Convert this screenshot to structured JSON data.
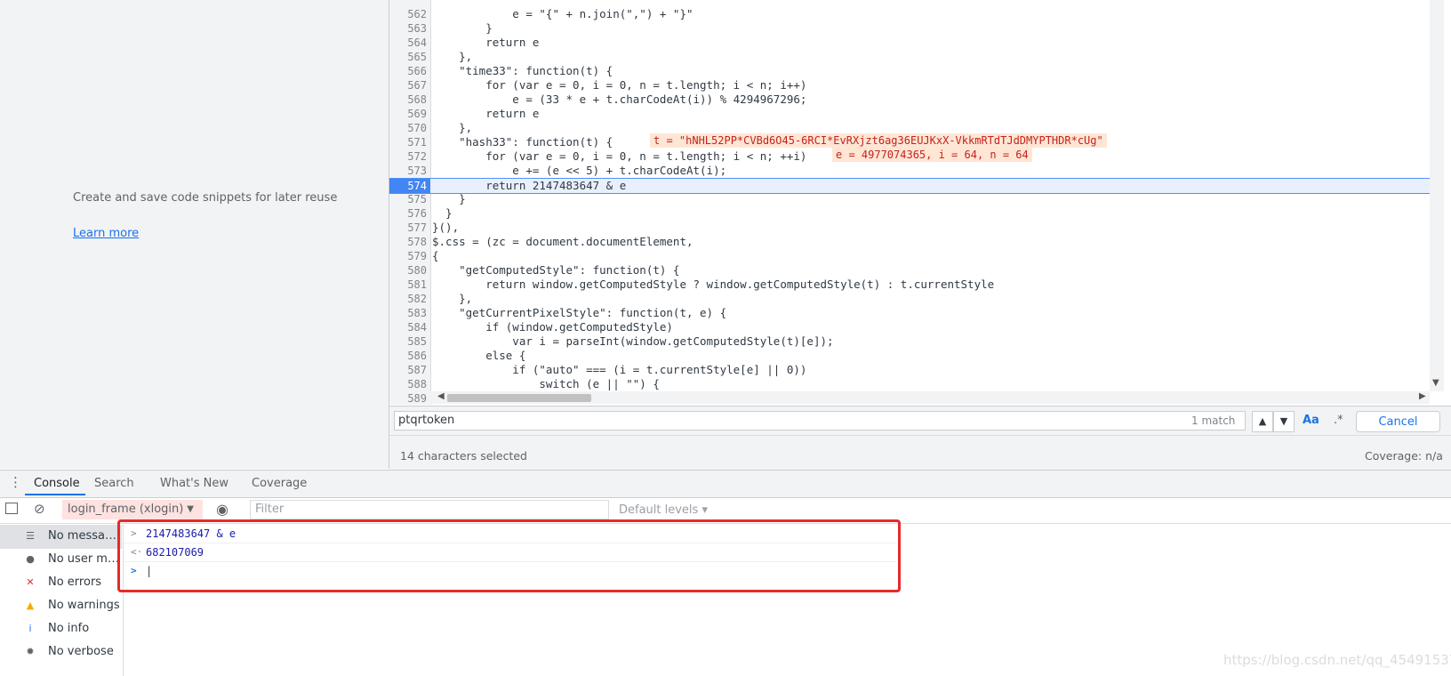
{
  "snippets": {
    "description": "Create and save code snippets for later reuse",
    "learn_more": "Learn more"
  },
  "editor": {
    "lines": [
      {
        "n": "562",
        "code": "            e = \"{\" + n.join(\",\") + \"}\""
      },
      {
        "n": "563",
        "code": "        }"
      },
      {
        "n": "564",
        "code": "        return e"
      },
      {
        "n": "565",
        "code": "    },"
      },
      {
        "n": "566",
        "code": "    \"time33\": function(t) {"
      },
      {
        "n": "567",
        "code": "        for (var e = 0, i = 0, n = t.length; i < n; i++)"
      },
      {
        "n": "568",
        "code": "            e = (33 * e + t.charCodeAt(i)) % 4294967296;"
      },
      {
        "n": "569",
        "code": "        return e"
      },
      {
        "n": "570",
        "code": "    },"
      },
      {
        "n": "571",
        "code": "    \"hash33\": function(t) {"
      },
      {
        "n": "572",
        "code": "        for (var e = 0, i = 0, n = t.length; i < n; ++i)"
      },
      {
        "n": "573",
        "code": "            e += (e << 5) + t.charCodeAt(i);"
      },
      {
        "n": "574",
        "code": "        return 2147483647 & e"
      },
      {
        "n": "575",
        "code": "    }"
      },
      {
        "n": "576",
        "code": "  }"
      },
      {
        "n": "577",
        "code": "}(),"
      },
      {
        "n": "578",
        "code": "$.css = (zc = document.documentElement,"
      },
      {
        "n": "579",
        "code": "{"
      },
      {
        "n": "580",
        "code": "    \"getComputedStyle\": function(t) {"
      },
      {
        "n": "581",
        "code": "        return window.getComputedStyle ? window.getComputedStyle(t) : t.currentStyle"
      },
      {
        "n": "582",
        "code": "    },"
      },
      {
        "n": "583",
        "code": "    \"getCurrentPixelStyle\": function(t, e) {"
      },
      {
        "n": "584",
        "code": "        if (window.getComputedStyle)"
      },
      {
        "n": "585",
        "code": "            var i = parseInt(window.getComputedStyle(t)[e]);"
      },
      {
        "n": "586",
        "code": "        else {"
      },
      {
        "n": "587",
        "code": "            if (\"auto\" === (i = t.currentStyle[e] || 0))"
      },
      {
        "n": "588",
        "code": "                switch (e || \"\") {"
      },
      {
        "n": "589",
        "code": ""
      }
    ],
    "current_line": "574",
    "inline_values": {
      "line571": "t = \"hNHL52PP*CVBd6O45-6RCI*EvRXjzt6ag36EUJKxX-VkkmRTdTJdDMYPTHDR*cUg\"",
      "line572": "e = 4977074365, i = 64, n = 64"
    }
  },
  "search": {
    "value": "ptqrtoken",
    "match_count": "1 match",
    "case_label": "Aa",
    "regex_label": ".*",
    "cancel_label": "Cancel"
  },
  "status": {
    "selection": "14 characters selected",
    "coverage": "Coverage: n/a"
  },
  "drawer": {
    "tabs": [
      "Console",
      "Search",
      "What's New",
      "Coverage"
    ]
  },
  "console_toolbar": {
    "context": "login_frame (xlogin)",
    "filter_placeholder": "Filter",
    "levels": "Default levels"
  },
  "console_sidebar": {
    "items": [
      {
        "label": "No messages",
        "icon": "list-icon"
      },
      {
        "label": "No user me...",
        "icon": "user-icon"
      },
      {
        "label": "No errors",
        "icon": "error-icon"
      },
      {
        "label": "No warnings",
        "icon": "warning-icon"
      },
      {
        "label": "No info",
        "icon": "info-icon"
      },
      {
        "label": "No verbose",
        "icon": "bug-icon"
      }
    ]
  },
  "console_log": {
    "input": "2147483647 & e",
    "result": "682107069"
  },
  "colors": {
    "highlight_box": "#e62a2a",
    "accent": "#1a73e8"
  },
  "watermark": "https://blog.csdn.net/qq_45491537"
}
